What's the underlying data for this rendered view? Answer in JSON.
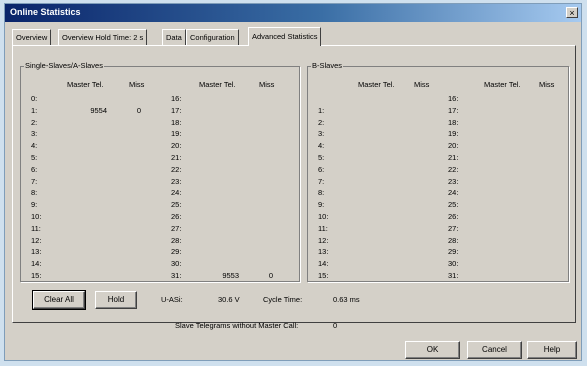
{
  "window": {
    "title": "Online Statistics",
    "close": "×"
  },
  "tabs": [
    {
      "label": "Overview"
    },
    {
      "label": "Overview  Hold Time: 2 s"
    },
    {
      "label": "Data"
    },
    {
      "label": "Configuration"
    },
    {
      "label": "Advanced Statistics"
    }
  ],
  "single": {
    "title": "Single-Slaves/A-Slaves",
    "hdr_master": "Master Tel.",
    "hdr_miss": "Miss",
    "left": [
      {
        "n": "0:",
        "m": "",
        "x": ""
      },
      {
        "n": "1:",
        "m": "9554",
        "x": "0"
      },
      {
        "n": "2:",
        "m": "",
        "x": ""
      },
      {
        "n": "3:",
        "m": "",
        "x": ""
      },
      {
        "n": "4:",
        "m": "",
        "x": ""
      },
      {
        "n": "5:",
        "m": "",
        "x": ""
      },
      {
        "n": "6:",
        "m": "",
        "x": ""
      },
      {
        "n": "7:",
        "m": "",
        "x": ""
      },
      {
        "n": "8:",
        "m": "",
        "x": ""
      },
      {
        "n": "9:",
        "m": "",
        "x": ""
      },
      {
        "n": "10:",
        "m": "",
        "x": ""
      },
      {
        "n": "11:",
        "m": "",
        "x": ""
      },
      {
        "n": "12:",
        "m": "",
        "x": ""
      },
      {
        "n": "13:",
        "m": "",
        "x": ""
      },
      {
        "n": "14:",
        "m": "",
        "x": ""
      },
      {
        "n": "15:",
        "m": "",
        "x": ""
      }
    ],
    "right": [
      {
        "n": "16:",
        "m": "",
        "x": ""
      },
      {
        "n": "17:",
        "m": "",
        "x": ""
      },
      {
        "n": "18:",
        "m": "",
        "x": ""
      },
      {
        "n": "19:",
        "m": "",
        "x": ""
      },
      {
        "n": "20:",
        "m": "",
        "x": ""
      },
      {
        "n": "21:",
        "m": "",
        "x": ""
      },
      {
        "n": "22:",
        "m": "",
        "x": ""
      },
      {
        "n": "23:",
        "m": "",
        "x": ""
      },
      {
        "n": "24:",
        "m": "",
        "x": ""
      },
      {
        "n": "25:",
        "m": "",
        "x": ""
      },
      {
        "n": "26:",
        "m": "",
        "x": ""
      },
      {
        "n": "27:",
        "m": "",
        "x": ""
      },
      {
        "n": "28:",
        "m": "",
        "x": ""
      },
      {
        "n": "29:",
        "m": "",
        "x": ""
      },
      {
        "n": "30:",
        "m": "",
        "x": ""
      },
      {
        "n": "31:",
        "m": "9553",
        "x": "0"
      }
    ]
  },
  "bslaves": {
    "title": "B-Slaves",
    "hdr_master": "Master Tel.",
    "hdr_miss": "Miss",
    "left": [
      "1:",
      "2:",
      "3:",
      "4:",
      "5:",
      "6:",
      "7:",
      "8:",
      "9:",
      "10:",
      "11:",
      "12:",
      "13:",
      "14:",
      "15:"
    ],
    "right": [
      "16:",
      "17:",
      "18:",
      "19:",
      "20:",
      "21:",
      "22:",
      "23:",
      "24:",
      "25:",
      "26:",
      "27:",
      "28:",
      "29:",
      "30:",
      "31:"
    ]
  },
  "footer": {
    "clear_all": "Clear All",
    "hold": "Hold",
    "uasi_label": "U-ASi:",
    "uasi_value": "30.6 V",
    "cycle_label": "Cycle Time:",
    "cycle_value": "0.63 ms",
    "slave_tel_label": "Slave Telegrams without Master Call:",
    "slave_tel_value": "0"
  },
  "buttons": {
    "ok": "OK",
    "cancel": "Cancel",
    "help": "Help"
  }
}
